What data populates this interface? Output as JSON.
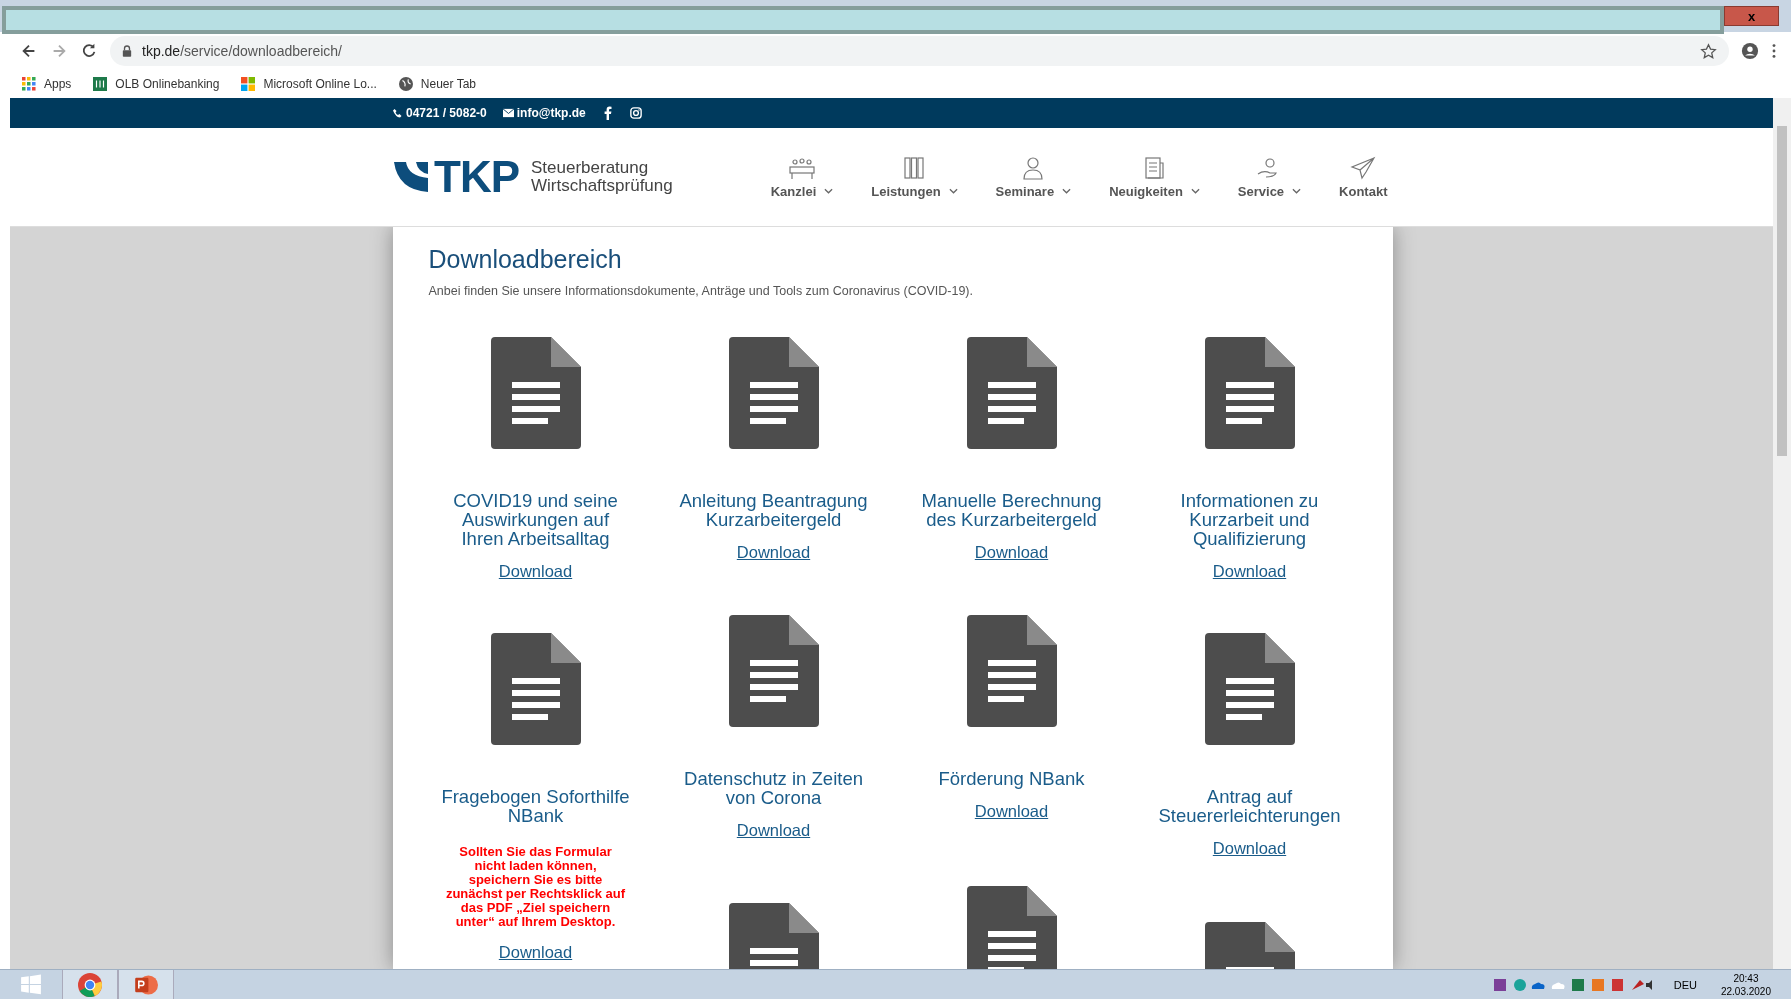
{
  "browser": {
    "url_host": "tkp.de",
    "url_path": "/service/downloadbereich/",
    "close": "x",
    "bookmarks": [
      {
        "label": "Apps",
        "kind": "apps"
      },
      {
        "label": "OLB Onlinebanking",
        "kind": "bank"
      },
      {
        "label": "Microsoft Online Lo...",
        "kind": "windows"
      },
      {
        "label": "Neuer Tab",
        "kind": "globe"
      }
    ]
  },
  "topbar": {
    "phone": "04721 / 5082-0",
    "email": "info@tkp.de"
  },
  "header": {
    "logo": "TKP",
    "tagline_1": "Steuerberatung",
    "tagline_2": "Wirtschaftsprüfung",
    "nav": [
      {
        "label": "Kanzlei",
        "kind": "people",
        "dropdown": true
      },
      {
        "label": "Leistungen",
        "kind": "binders",
        "dropdown": true
      },
      {
        "label": "Seminare",
        "kind": "person",
        "dropdown": true
      },
      {
        "label": "Neuigkeiten",
        "kind": "news",
        "dropdown": true
      },
      {
        "label": "Service",
        "kind": "hand",
        "dropdown": true
      },
      {
        "label": "Kontakt",
        "kind": "plane",
        "dropdown": false
      }
    ]
  },
  "content": {
    "title": "Downloadbereich",
    "intro": "Anbei finden Sie unsere Informationsdokumente, Anträge und Tools zum Coronavirus (COVID-19).",
    "rows": [
      [
        {
          "kind": "document",
          "title": "COVID19 und seine Auswirkungen auf Ihren Arbeitsalltag",
          "link": "Download"
        },
        {
          "kind": "document",
          "title": "Anleitung Beantragung Kurzarbeitergeld",
          "link": "Download"
        },
        {
          "kind": "document",
          "title": "Manuelle Berechnung des Kurzarbeitergeld",
          "link": "Download"
        },
        {
          "kind": "document",
          "title": "Informationen zu Kurzarbeit und Qualifizierung",
          "link": "Download"
        }
      ],
      [
        {
          "kind": "document",
          "title": "Fragebogen Soforthilfe NBank",
          "note": "Sollten Sie das Formular nicht laden können, speichern Sie es bitte zunächst per Rechtsklick auf das PDF „Ziel speichern unter“ auf Ihrem Desktop.",
          "link": "Download"
        },
        {
          "kind": "document",
          "title": "Datenschutz in Zeiten von Corona",
          "link": "Download"
        },
        {
          "kind": "document",
          "title": "Förderung NBank",
          "link": "Download"
        },
        {
          "kind": "document",
          "title": "Antrag auf Steuererleichterungen",
          "link": "Download"
        }
      ],
      [
        {
          "kind": "document"
        },
        {
          "kind": "document"
        },
        {
          "kind": "document"
        }
      ]
    ]
  },
  "taskbar": {
    "language": "DEU",
    "time": "20:43",
    "date": "22.03.2020"
  }
}
